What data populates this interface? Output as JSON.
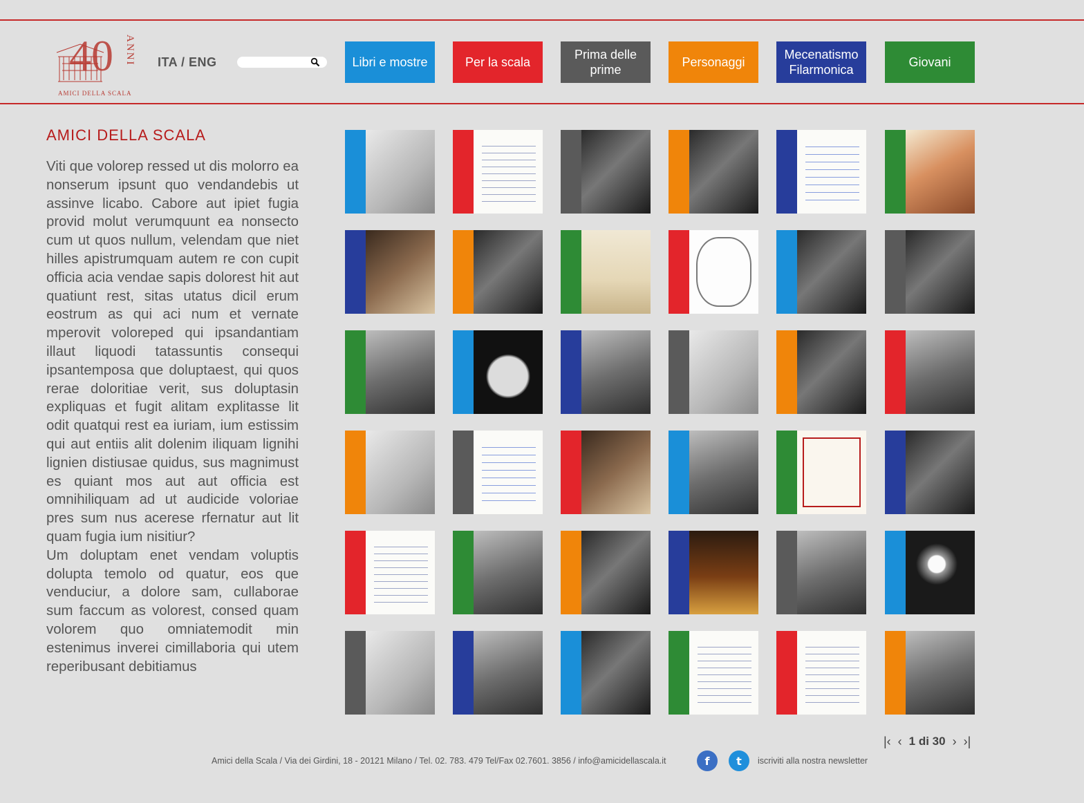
{
  "header": {
    "logo_number": "40",
    "logo_word": "ANNI",
    "logo_caption": "AMICI DELLA SCALA",
    "lang": "ITA / ENG",
    "search_placeholder": ""
  },
  "colors": {
    "blue": "#1a8fd8",
    "red": "#e3252b",
    "gray": "#5a5a5a",
    "orange": "#f0850a",
    "navy": "#273d9b",
    "green": "#2e8b35",
    "accent": "#c62828"
  },
  "nav": [
    {
      "label": "Libri e mostre",
      "color": "blue"
    },
    {
      "label": "Per la scala",
      "color": "red"
    },
    {
      "label": "Prima delle prime",
      "color": "gray"
    },
    {
      "label": "Personaggi",
      "color": "orange"
    },
    {
      "label": "Mecenatismo Filarmonica",
      "color": "navy"
    },
    {
      "label": "Giovani",
      "color": "green"
    }
  ],
  "main": {
    "title": "AMICI DELLA SCALA",
    "paragraph1": "Viti que volorep ressed ut dis molorro ea nonserum ipsunt quo vendandebis ut assinve licabo. Cabore aut ipiet fugia provid molut verumquunt ea nonsecto cum ut quos nullum, velendam que niet hilles apistrumquam autem re con cupit officia acia vendae sapis dolorest hit aut quatiunt rest, sitas utatus dicil erum eostrum as qui aci num et vernate mperovit voloreped qui ipsandantiam illaut liquodi tatassuntis consequi ipsantemposa que doluptaest, qui quos rerae doloritiae verit, sus doluptasin expliquas et fugit alitam explitasse lit odit quatqui rest ea iuriam, ium estissim qui aut entiis alit dolenim iliquam lignihi lignien distiusae quidus, sus magnimust es quiant mos aut aut officia est omnihiliquam ad ut audicide voloriae pres sum nus acerese rfernatur aut lit quam fugia ium nisitiur?",
    "paragraph2": "Um doluptam enet vendam voluptis dolupta temolo od quatur, eos que venduciur, a dolore sam, cullaborae sum faccum as volorest, consed quam volorem quo omniatemodit min estenimus inverei cimillaboria qui utem reperibusant debitiamus"
  },
  "tiles": [
    {
      "stripe": "blue",
      "photo": "light"
    },
    {
      "stripe": "red",
      "photo": "paper"
    },
    {
      "stripe": "gray",
      "photo": "dark"
    },
    {
      "stripe": "orange",
      "photo": "dark"
    },
    {
      "stripe": "navy",
      "photo": "paper blue"
    },
    {
      "stripe": "green",
      "photo": "warm"
    },
    {
      "stripe": "navy",
      "photo": "sepia"
    },
    {
      "stripe": "orange",
      "photo": "dark"
    },
    {
      "stripe": "green",
      "photo": "book"
    },
    {
      "stripe": "red",
      "photo": "score"
    },
    {
      "stripe": "blue",
      "photo": "dark"
    },
    {
      "stripe": "gray",
      "photo": "dark"
    },
    {
      "stripe": "green",
      "photo": "mid"
    },
    {
      "stripe": "blue",
      "photo": "globe"
    },
    {
      "stripe": "navy",
      "photo": "mid"
    },
    {
      "stripe": "gray",
      "photo": "light"
    },
    {
      "stripe": "orange",
      "photo": "dark"
    },
    {
      "stripe": "red",
      "photo": "mid"
    },
    {
      "stripe": "orange",
      "photo": "light"
    },
    {
      "stripe": "gray",
      "photo": "paper blue"
    },
    {
      "stripe": "red",
      "photo": "sepia"
    },
    {
      "stripe": "blue",
      "photo": "mid"
    },
    {
      "stripe": "green",
      "photo": "redbook"
    },
    {
      "stripe": "navy",
      "photo": "dark"
    },
    {
      "stripe": "red",
      "photo": "paper"
    },
    {
      "stripe": "green",
      "photo": "mid"
    },
    {
      "stripe": "orange",
      "photo": "dark"
    },
    {
      "stripe": "navy",
      "photo": "orchestra"
    },
    {
      "stripe": "gray",
      "photo": "mid"
    },
    {
      "stripe": "blue",
      "photo": "moon"
    },
    {
      "stripe": "gray",
      "photo": "light"
    },
    {
      "stripe": "navy",
      "photo": "mid"
    },
    {
      "stripe": "blue",
      "photo": "dark"
    },
    {
      "stripe": "green",
      "photo": "paper"
    },
    {
      "stripe": "red",
      "photo": "paper"
    },
    {
      "stripe": "orange",
      "photo": "mid"
    }
  ],
  "pagination": {
    "text": "1 di 30",
    "first": "K",
    "prev": "<",
    "next": ">",
    "last": ">|"
  },
  "footer": {
    "address": "Amici della Scala / Via dei Girdini, 18 - 20121 Milano / Tel. 02. 783. 479  Tel/Fax 02.7601. 3856 / info@amicidellascala.it",
    "facebook": "f",
    "twitter": "t",
    "newsletter": "iscriviti alla nostra newsletter",
    "facebook_color": "#3b6fc4",
    "twitter_color": "#1f8fdb"
  }
}
